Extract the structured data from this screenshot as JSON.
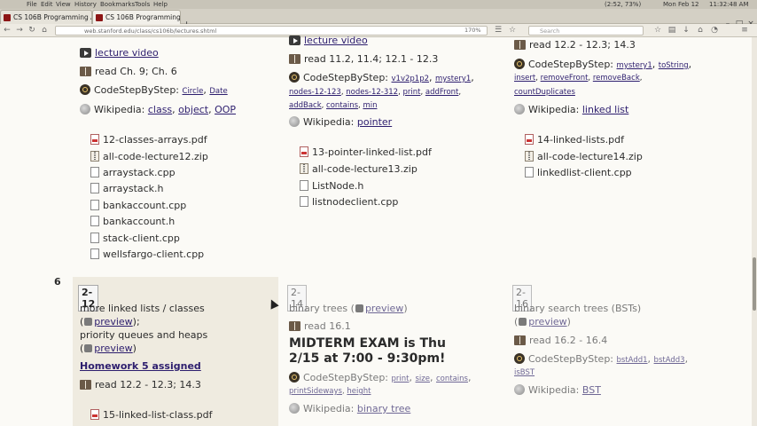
{
  "menubar": {
    "items": [
      "File",
      "Edit",
      "View",
      "History",
      "Bookmarks",
      "Tools",
      "Help"
    ],
    "status": [
      "(2:52, 73%)",
      "Mon Feb 12",
      "11:32:48 AM"
    ]
  },
  "tabs": [
    {
      "label": "CS 106B Programming A..."
    },
    {
      "label": "CS 106B Programming A..."
    }
  ],
  "newtab": "+",
  "nav": {
    "url": "web.stanford.edu/class/cs106b/lectures.shtml",
    "zoom": "170%",
    "search_placeholder": "Search"
  },
  "week5": {
    "col1": {
      "lecture_video": "lecture video",
      "read": "read Ch. 9; Ch. 6",
      "codestep_label": "CodeStepByStep:",
      "codestep_links": [
        "Circle",
        "Date"
      ],
      "wiki_label": "Wikipedia:",
      "wiki_links": [
        "class",
        "object",
        "OOP"
      ],
      "files": [
        "12-classes-arrays.pdf",
        "all-code-lecture12.zip",
        "arraystack.cpp",
        "arraystack.h",
        "bankaccount.cpp",
        "bankaccount.h",
        "stack-client.cpp",
        "wellsfargo-client.cpp"
      ]
    },
    "col2": {
      "lecture_video": "lecture video",
      "read": "read 11.2, 11.4; 12.1 - 12.3",
      "codestep_label": "CodeStepByStep:",
      "codestep_links": [
        "v1v2p1p2",
        "mystery1",
        "nodes-12-123",
        "nodes-12-312",
        "print",
        "addFront",
        "addBack",
        "contains",
        "min"
      ],
      "wiki_label": "Wikipedia:",
      "wiki_links": [
        "pointer"
      ],
      "files": [
        "13-pointer-linked-list.pdf",
        "all-code-lecture13.zip",
        "ListNode.h",
        "listnodeclient.cpp"
      ]
    },
    "col3": {
      "read": "read 12.2 - 12.3; 14.3",
      "codestep_label": "CodeStepByStep:",
      "codestep_links": [
        "mystery1",
        "toString",
        "insert",
        "removeFront",
        "removeBack",
        "countDuplicates"
      ],
      "wiki_label": "Wikipedia:",
      "wiki_links": [
        "linked list"
      ],
      "files": [
        "14-linked-lists.pdf",
        "all-code-lecture14.zip",
        "linkedlist-client.cpp"
      ]
    }
  },
  "week6": {
    "week_number": "6",
    "col1": {
      "date": "2-12",
      "topic1": "more linked lists / classes",
      "preview1": "preview",
      "topic2": "priority queues and heaps",
      "preview2": "preview",
      "homework": "Homework 5 assigned",
      "read": "read 12.2 - 12.3; 14.3",
      "file": "15-linked-list-class.pdf"
    },
    "col2": {
      "date": "2-14",
      "topic": "binary trees",
      "preview": "preview",
      "read": "read 16.1",
      "midterm": "MIDTERM EXAM is Thu 2/15 at 7:00 - 9:30pm!",
      "codestep_label": "CodeStepByStep:",
      "codestep_links": [
        "print",
        "size",
        "contains",
        "printSideways",
        "height"
      ],
      "wiki_label": "Wikipedia:",
      "wiki_links": [
        "binary tree"
      ]
    },
    "col3": {
      "date": "2-16",
      "topic": "binary search trees (BSTs)",
      "preview": "preview",
      "read": "read 16.2 - 16.4",
      "codestep_label": "CodeStepByStep:",
      "codestep_links": [
        "bstAdd1",
        "bstAdd3",
        "isBST"
      ],
      "wiki_label": "Wikipedia:",
      "wiki_links": [
        "BST"
      ]
    }
  }
}
